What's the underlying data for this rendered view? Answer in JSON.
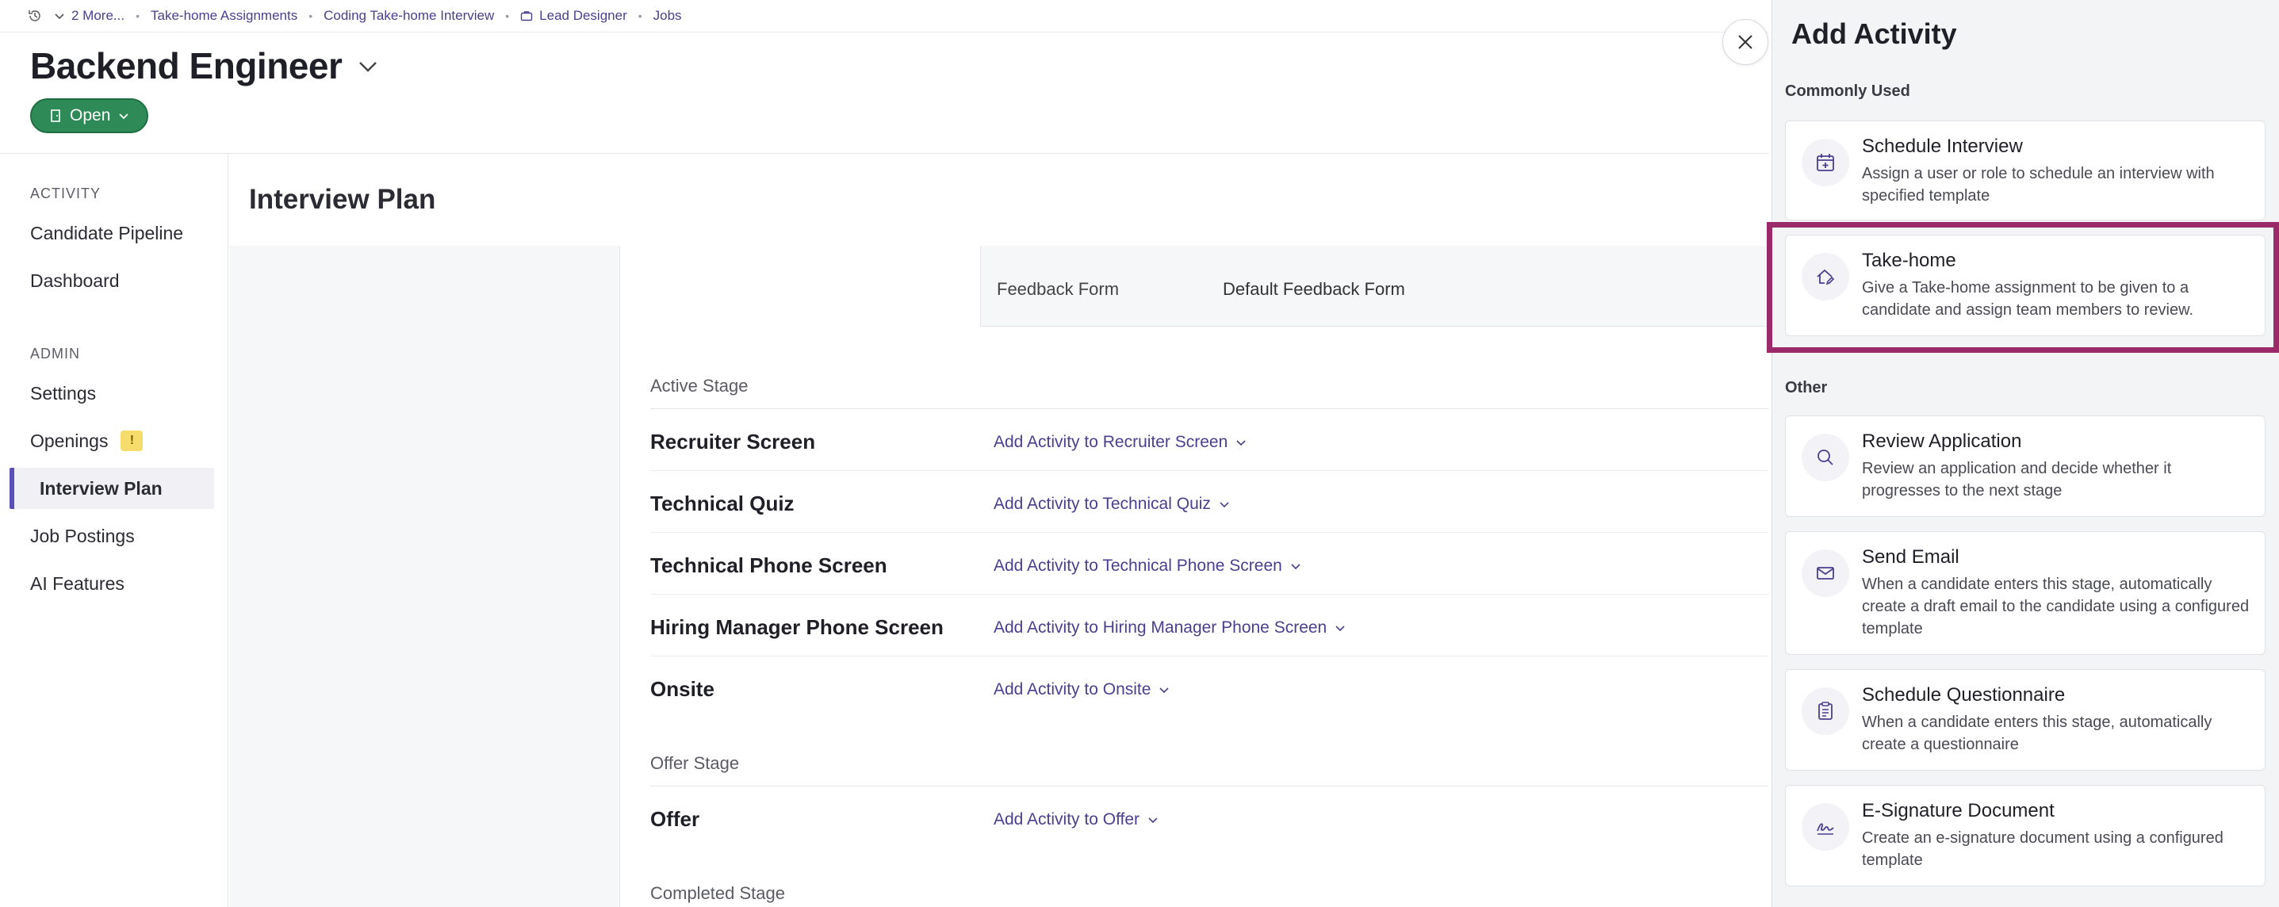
{
  "breadcrumb": {
    "more": "2 More...",
    "items": [
      "Take-home Assignments",
      "Coding Take-home Interview",
      "Lead Designer",
      "Jobs"
    ]
  },
  "job": {
    "title": "Backend Engineer",
    "status": "Open"
  },
  "sidebar": {
    "sections": [
      {
        "label": "ACTIVITY",
        "items": [
          "Candidate Pipeline",
          "Dashboard"
        ]
      },
      {
        "label": "ADMIN",
        "items": [
          "Settings",
          "Openings",
          "Interview Plan",
          "Job Postings",
          "AI Features"
        ]
      }
    ],
    "active": "Interview Plan",
    "openings_badge": "!"
  },
  "main": {
    "title": "Interview Plan",
    "feedback": {
      "label": "Feedback Form",
      "value": "Default Feedback Form"
    },
    "active_stage": {
      "label": "Active Stage",
      "rows": [
        {
          "name": "Recruiter Screen",
          "action": "Add Activity to Recruiter Screen"
        },
        {
          "name": "Technical Quiz",
          "action": "Add Activity to Technical Quiz"
        },
        {
          "name": "Technical Phone Screen",
          "action": "Add Activity to Technical Phone Screen"
        },
        {
          "name": "Hiring Manager Phone Screen",
          "action": "Add Activity to Hiring Manager Phone Screen"
        },
        {
          "name": "Onsite",
          "action": "Add Activity to Onsite"
        }
      ]
    },
    "offer_stage": {
      "label": "Offer Stage",
      "rows": [
        {
          "name": "Offer",
          "action": "Add Activity to Offer"
        }
      ]
    },
    "completed_stage": {
      "label": "Completed Stage"
    }
  },
  "drawer": {
    "title": "Add Activity",
    "commonly_used_label": "Commonly Used",
    "other_label": "Other",
    "commonly_used": [
      {
        "icon": "calendar-plus-icon",
        "title": "Schedule Interview",
        "desc": "Assign a user or role to schedule an interview with specified template"
      },
      {
        "icon": "house-edit-icon",
        "title": "Take-home",
        "desc": "Give a Take-home assignment to be given to a candidate and assign team members to review."
      }
    ],
    "other": [
      {
        "icon": "search-icon",
        "title": "Review Application",
        "desc": "Review an application and decide whether it progresses to the next stage"
      },
      {
        "icon": "mail-icon",
        "title": "Send Email",
        "desc": "When a candidate enters this stage, automatically create a draft email to the candidate using a configured template"
      },
      {
        "icon": "clipboard-icon",
        "title": "Schedule Questionnaire",
        "desc": "When a candidate enters this stage, automatically create a questionnaire"
      },
      {
        "icon": "signature-icon",
        "title": "E-Signature Document",
        "desc": "Create an e-signature document using a configured template"
      }
    ]
  },
  "colors": {
    "accent": "#4b3f8f",
    "open_green": "#2e8b57",
    "highlight": "#9b2a6b"
  }
}
